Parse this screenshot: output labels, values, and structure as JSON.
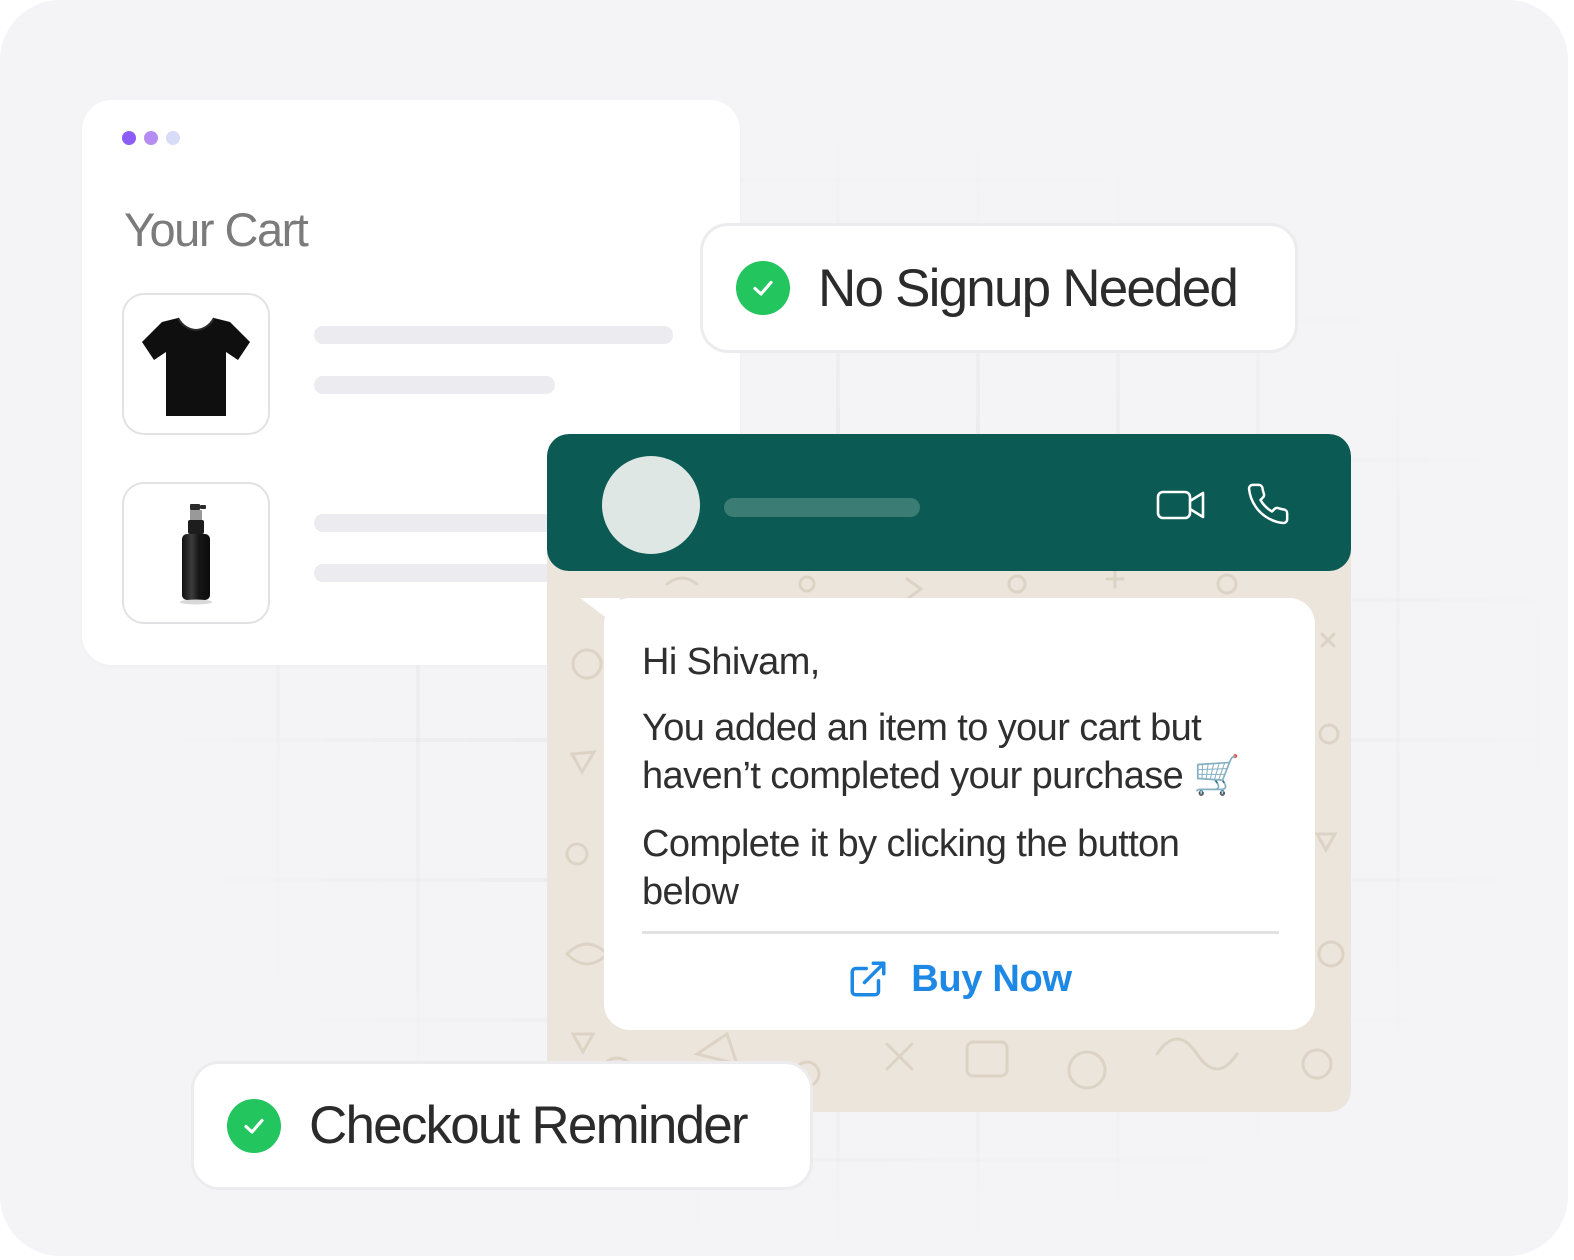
{
  "colors": {
    "accent_green": "#22c55e",
    "header_teal": "#0b5a53",
    "link_blue": "#1e88e5",
    "dot_colors": [
      "#8b5cf6",
      "#b58df2",
      "#d9dcf7"
    ]
  },
  "cart": {
    "title": "Your Cart",
    "items": [
      {
        "icon": "tshirt-icon"
      },
      {
        "icon": "bottle-icon"
      }
    ]
  },
  "badges": {
    "signup": "No Signup Needed",
    "reminder": "Checkout Reminder"
  },
  "chat": {
    "header_icons": [
      "video-call-icon",
      "phone-icon"
    ],
    "greeting": "Hi Shivam,",
    "message_line1": "You added an item to your cart but",
    "message_line2": "haven’t completed your purchase",
    "cart_emoji": "🛒",
    "instruction_line1": "Complete it by clicking the button",
    "instruction_line2": "below",
    "button_label": "Buy Now",
    "button_icon": "external-link-icon"
  }
}
